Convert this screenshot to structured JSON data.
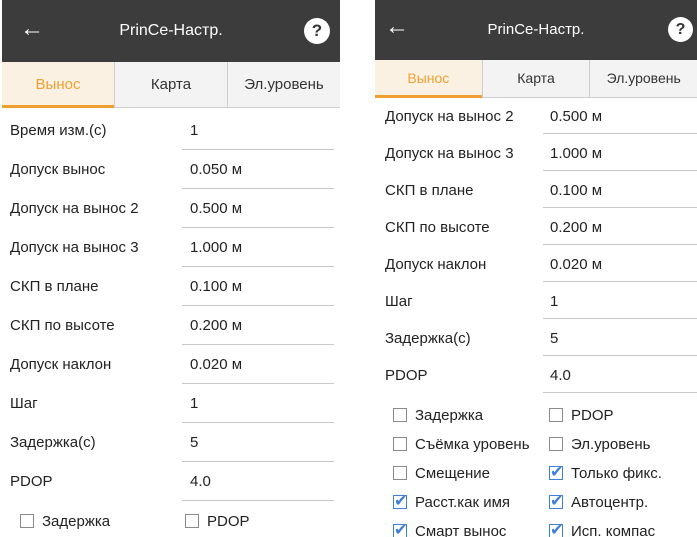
{
  "left": {
    "appbar": {
      "back_icon": "arrow-left-icon",
      "title": "PrinCe-Настр.",
      "help": "?"
    },
    "tabs": [
      {
        "label": "Вынос",
        "active": true
      },
      {
        "label": "Карта",
        "active": false
      },
      {
        "label": "Эл.уровень",
        "active": false
      }
    ],
    "rows": [
      {
        "label": "Время изм.(с)",
        "value": "1"
      },
      {
        "label": "Допуск вынос",
        "value": "0.050 м"
      },
      {
        "label": "Допуск на вынос 2",
        "value": "0.500 м"
      },
      {
        "label": "Допуск на вынос 3",
        "value": "1.000 м"
      },
      {
        "label": "СКП в плане",
        "value": "0.100 м"
      },
      {
        "label": "СКП по высоте",
        "value": "0.200 м"
      },
      {
        "label": "Допуск наклон",
        "value": "0.020 м"
      },
      {
        "label": "Шаг",
        "value": "1"
      },
      {
        "label": "Задержка(с)",
        "value": "5"
      },
      {
        "label": "PDOP",
        "value": "4.0"
      }
    ],
    "checkboxes": [
      {
        "left": {
          "label": "Задержка",
          "checked": false
        },
        "right": {
          "label": "PDOP",
          "checked": false
        }
      }
    ]
  },
  "right": {
    "appbar": {
      "back_icon": "arrow-left-icon",
      "title": "PrinCe-Настр.",
      "help": "?"
    },
    "tabs": [
      {
        "label": "Вынос",
        "active": true
      },
      {
        "label": "Карта",
        "active": false
      },
      {
        "label": "Эл.уровень",
        "active": false
      }
    ],
    "rows": [
      {
        "label": "Допуск на вынос 2",
        "value": "0.500 м"
      },
      {
        "label": "Допуск на вынос 3",
        "value": "1.000 м"
      },
      {
        "label": "СКП в плане",
        "value": "0.100 м"
      },
      {
        "label": "СКП по высоте",
        "value": "0.200 м"
      },
      {
        "label": "Допуск наклон",
        "value": "0.020 м"
      },
      {
        "label": "Шаг",
        "value": "1"
      },
      {
        "label": "Задержка(с)",
        "value": "5"
      },
      {
        "label": "PDOP",
        "value": "4.0"
      }
    ],
    "checkboxes": [
      {
        "left": {
          "label": "Задержка",
          "checked": false
        },
        "right": {
          "label": "PDOP",
          "checked": false
        }
      },
      {
        "left": {
          "label": "Съёмка уровень",
          "checked": false
        },
        "right": {
          "label": "Эл.уровень",
          "checked": false
        }
      },
      {
        "left": {
          "label": "Смещение",
          "checked": false
        },
        "right": {
          "label": "Только фикс.",
          "checked": true
        }
      },
      {
        "left": {
          "label": "Расст.как имя",
          "checked": true
        },
        "right": {
          "label": "Автоцентр.",
          "checked": true
        }
      },
      {
        "left": {
          "label": "Смарт вынос",
          "checked": true
        },
        "right": {
          "label": "Исп. компас",
          "checked": true
        }
      }
    ]
  },
  "colors": {
    "appbar": "#3c3c3c",
    "accent": "#f0a030",
    "check": "#3d7fd9"
  }
}
